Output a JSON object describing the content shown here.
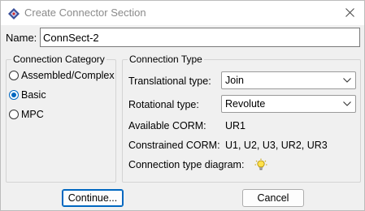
{
  "window": {
    "title": "Create Connector Section",
    "app_icon": "abaqus-icon",
    "close_icon": "close-icon",
    "accent": "#0067c0"
  },
  "name_field": {
    "label": "Name:",
    "value": "ConnSect-2"
  },
  "connection_category": {
    "legend": "Connection Category",
    "options": [
      {
        "label": "Assembled/Complex",
        "checked": false
      },
      {
        "label": "Basic",
        "checked": true
      },
      {
        "label": "MPC",
        "checked": false
      }
    ]
  },
  "connection_type": {
    "legend": "Connection Type",
    "translational": {
      "label": "Translational type:",
      "value": "Join"
    },
    "rotational": {
      "label": "Rotational type:",
      "value": "Revolute"
    },
    "available_corm": {
      "label": "Available CORM:",
      "value": "UR1"
    },
    "constrained_corm": {
      "label": "Constrained CORM:",
      "value": "U1, U2, U3, UR2, UR3"
    },
    "diagram": {
      "label": "Connection type diagram:",
      "icon": "lightbulb-icon"
    }
  },
  "buttons": {
    "continue_label": "Continue...",
    "cancel_label": "Cancel"
  }
}
